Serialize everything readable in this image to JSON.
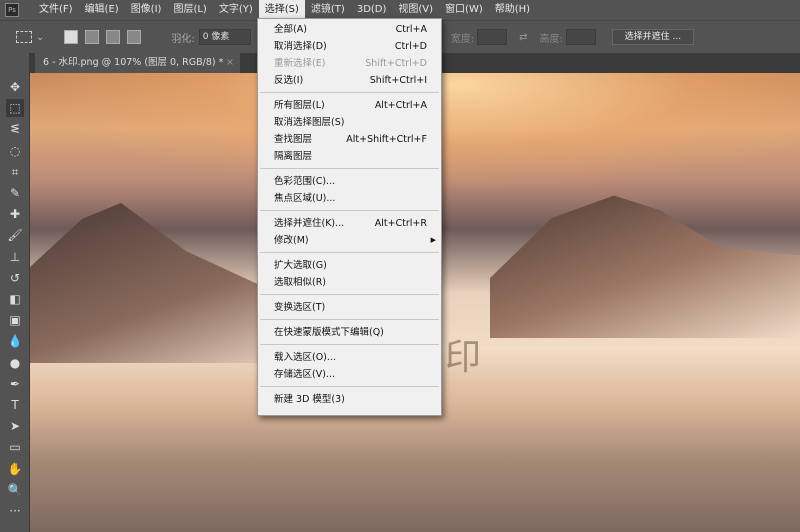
{
  "menubar": {
    "logo": "Ps",
    "items": [
      "文件(F)",
      "编辑(E)",
      "图像(I)",
      "图层(L)",
      "文字(Y)",
      "选择(S)",
      "滤镜(T)",
      "3D(D)",
      "视图(V)",
      "窗口(W)",
      "帮助(H)"
    ]
  },
  "options": {
    "feather_label": "羽化:",
    "feather_value": "0 像素",
    "width_label": "宽度:",
    "height_label": "高度:",
    "select_mask_button": "选择并遮住 ..."
  },
  "document": {
    "tab_title": "6 - 水印.png @ 107% (图层 0, RGB/8) *",
    "close": "×",
    "watermark": "印"
  },
  "select_menu": {
    "groups": [
      [
        {
          "label": "全部(A)",
          "shortcut": "Ctrl+A"
        },
        {
          "label": "取消选择(D)",
          "shortcut": "Ctrl+D"
        },
        {
          "label": "重新选择(E)",
          "shortcut": "Shift+Ctrl+D",
          "disabled": true
        },
        {
          "label": "反选(I)",
          "shortcut": "Shift+Ctrl+I"
        }
      ],
      [
        {
          "label": "所有图层(L)",
          "shortcut": "Alt+Ctrl+A"
        },
        {
          "label": "取消选择图层(S)",
          "shortcut": ""
        },
        {
          "label": "查找图层",
          "shortcut": "Alt+Shift+Ctrl+F"
        },
        {
          "label": "隔离图层",
          "shortcut": ""
        }
      ],
      [
        {
          "label": "色彩范围(C)...",
          "shortcut": ""
        },
        {
          "label": "焦点区域(U)...",
          "shortcut": ""
        }
      ],
      [
        {
          "label": "选择并遮住(K)...",
          "shortcut": "Alt+Ctrl+R"
        },
        {
          "label": "修改(M)",
          "shortcut": "",
          "submenu": true
        }
      ],
      [
        {
          "label": "扩大选取(G)",
          "shortcut": ""
        },
        {
          "label": "选取相似(R)",
          "shortcut": ""
        }
      ],
      [
        {
          "label": "变换选区(T)",
          "shortcut": ""
        }
      ],
      [
        {
          "label": "在快速蒙版模式下编辑(Q)",
          "shortcut": ""
        }
      ],
      [
        {
          "label": "载入选区(O)...",
          "shortcut": ""
        },
        {
          "label": "存储选区(V)...",
          "shortcut": ""
        }
      ],
      [
        {
          "label": "新建 3D 模型(3)",
          "shortcut": ""
        }
      ]
    ]
  },
  "tools": [
    {
      "icon": "move-icon",
      "glyph": "✥"
    },
    {
      "icon": "marquee-icon",
      "glyph": "⬚"
    },
    {
      "icon": "lasso-icon",
      "glyph": "ᓬ"
    },
    {
      "icon": "quick-select-icon",
      "glyph": "◌"
    },
    {
      "icon": "crop-icon",
      "glyph": "⌗"
    },
    {
      "icon": "eyedropper-icon",
      "glyph": "✎"
    },
    {
      "icon": "healing-icon",
      "glyph": "✚"
    },
    {
      "icon": "brush-icon",
      "glyph": "🖌"
    },
    {
      "icon": "stamp-icon",
      "glyph": "⊥"
    },
    {
      "icon": "history-brush-icon",
      "glyph": "↺"
    },
    {
      "icon": "eraser-icon",
      "glyph": "◧"
    },
    {
      "icon": "gradient-icon",
      "glyph": "▣"
    },
    {
      "icon": "blur-icon",
      "glyph": "💧"
    },
    {
      "icon": "dodge-icon",
      "glyph": "●"
    },
    {
      "icon": "pen-icon",
      "glyph": "✒"
    },
    {
      "icon": "type-icon",
      "glyph": "T"
    },
    {
      "icon": "path-select-icon",
      "glyph": "➤"
    },
    {
      "icon": "shape-icon",
      "glyph": "▭"
    },
    {
      "icon": "hand-icon",
      "glyph": "✋"
    },
    {
      "icon": "zoom-icon",
      "glyph": "🔍"
    },
    {
      "icon": "more-icon",
      "glyph": "···"
    }
  ]
}
